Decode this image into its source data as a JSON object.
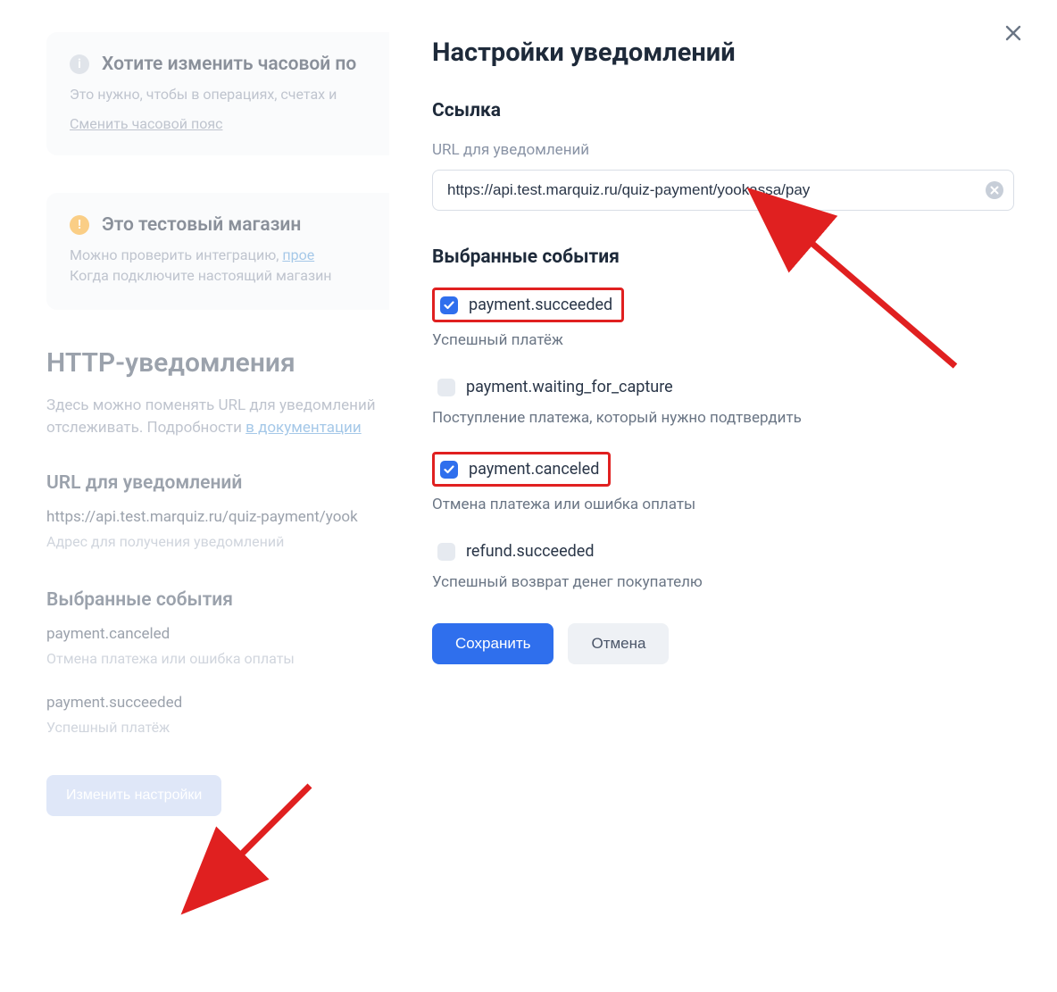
{
  "bg": {
    "tz_box": {
      "title": "Хотите изменить часовой по",
      "text": "Это нужно, чтобы в операциях, счетах и",
      "link": "Сменить часовой пояс"
    },
    "test_box": {
      "title": "Это тестовый магазин",
      "text1": "Можно проверить интеграцию, ",
      "link1": "прое",
      "text2": "Когда подключите настоящий магазин"
    },
    "h1": "HTTP-уведомления",
    "sub_a": "Здесь можно поменять URL для уведомлений",
    "sub_b": "отслеживать. Подробности ",
    "doclink": "в документации",
    "url_heading": "URL для уведомлений",
    "url_value": "https://api.test.marquiz.ru/quiz-payment/yook",
    "url_helper": "Адрес для получения уведомлений",
    "events_heading": "Выбранные события",
    "evt1_t": "payment.canceled",
    "evt1_d": "Отмена платежа или ошибка оплаты",
    "evt2_t": "payment.succeeded",
    "evt2_d": "Успешный платёж",
    "change_btn": "Изменить настройки"
  },
  "panel": {
    "title": "Настройки уведомлений",
    "link_section": "Ссылка",
    "url_label": "URL для уведомлений",
    "url_value": "https://api.test.marquiz.ru/quiz-payment/yookassa/pay",
    "events_heading": "Выбранные события",
    "events": {
      "e1": {
        "label": "payment.succeeded",
        "desc": "Успешный платёж"
      },
      "e2": {
        "label": "payment.waiting_for_capture",
        "desc": "Поступление платежа, который нужно подтвердить"
      },
      "e3": {
        "label": "payment.canceled",
        "desc": "Отмена платежа или ошибка оплаты"
      },
      "e4": {
        "label": "refund.succeeded",
        "desc": "Успешный возврат денег покупателю"
      }
    },
    "save": "Сохранить",
    "cancel": "Отмена"
  }
}
